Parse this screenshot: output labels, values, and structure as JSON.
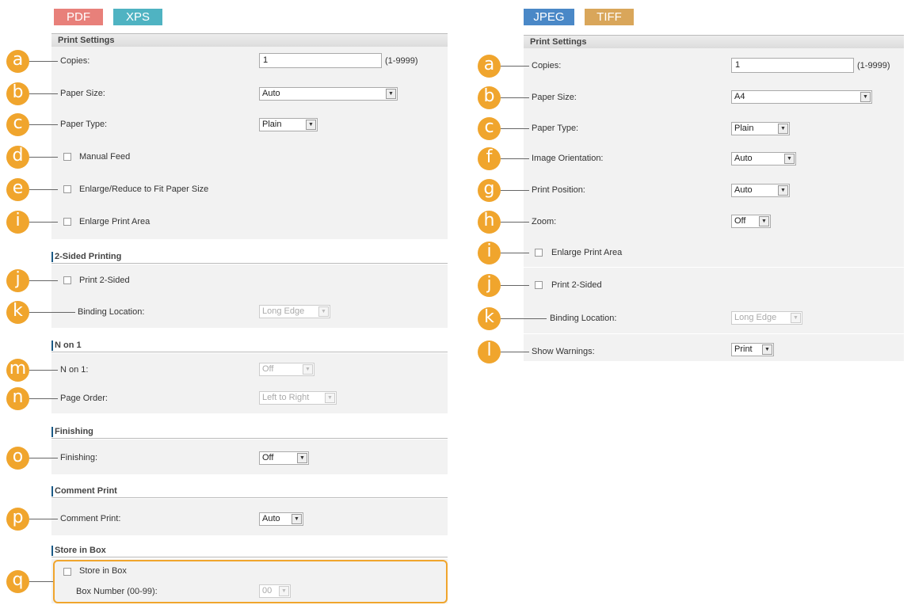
{
  "left": {
    "tabs": [
      {
        "label": "PDF",
        "color": "#e8807a"
      },
      {
        "label": "XPS",
        "color": "#4fb3c2"
      }
    ],
    "header": "Print Settings",
    "copies": {
      "badge": "a",
      "label": "Copies:",
      "value": "1",
      "range": "(1-9999)"
    },
    "paper_size": {
      "badge": "b",
      "label": "Paper Size:",
      "value": "Auto"
    },
    "paper_type": {
      "badge": "c",
      "label": "Paper Type:",
      "value": "Plain"
    },
    "manual_feed": {
      "badge": "d",
      "label": "Manual Feed"
    },
    "enlarge_reduce": {
      "badge": "e",
      "label": "Enlarge/Reduce to Fit Paper Size"
    },
    "enlarge_area": {
      "badge": "i",
      "label": "Enlarge Print Area"
    },
    "two_sided": {
      "title": "2-Sided Printing",
      "print": {
        "badge": "j",
        "label": "Print 2-Sided"
      },
      "binding": {
        "badge": "k",
        "label": "Binding Location:",
        "value": "Long Edge"
      }
    },
    "n_on_1": {
      "title": "N on 1",
      "n": {
        "badge": "m",
        "label": "N on 1:",
        "value": "Off"
      },
      "order": {
        "badge": "n",
        "label": "Page Order:",
        "value": "Left to Right"
      }
    },
    "finishing": {
      "title": "Finishing",
      "badge": "o",
      "label": "Finishing:",
      "value": "Off"
    },
    "comment": {
      "title": "Comment Print",
      "badge": "p",
      "label": "Comment Print:",
      "value": "Auto"
    },
    "store": {
      "title": "Store in Box",
      "badge": "q",
      "checkbox": "Store in Box",
      "box_label": "Box Number (00-99):",
      "box_value": "00"
    }
  },
  "right": {
    "tabs": [
      {
        "label": "JPEG",
        "color": "#4a88c7"
      },
      {
        "label": "TIFF",
        "color": "#d9a65a"
      }
    ],
    "header": "Print Settings",
    "copies": {
      "badge": "a",
      "label": "Copies:",
      "value": "1",
      "range": "(1-9999)"
    },
    "paper_size": {
      "badge": "b",
      "label": "Paper Size:",
      "value": "A4"
    },
    "paper_type": {
      "badge": "c",
      "label": "Paper Type:",
      "value": "Plain"
    },
    "orientation": {
      "badge": "f",
      "label": "Image Orientation:",
      "value": "Auto"
    },
    "position": {
      "badge": "g",
      "label": "Print Position:",
      "value": "Auto"
    },
    "zoom": {
      "badge": "h",
      "label": "Zoom:",
      "value": "Off"
    },
    "enlarge_area": {
      "badge": "i",
      "label": "Enlarge Print Area"
    },
    "two_sided": {
      "badge": "j",
      "label": "Print 2-Sided"
    },
    "binding": {
      "badge": "k",
      "label": "Binding Location:",
      "value": "Long Edge"
    },
    "warnings": {
      "badge": "l",
      "label": "Show Warnings:",
      "value": "Print"
    }
  },
  "colors": {
    "badge": "#f0a52d",
    "section_bar": "#1b5a86",
    "panel_bg": "#f2f2f2"
  },
  "icons": {
    "select_arrow": "▼"
  }
}
